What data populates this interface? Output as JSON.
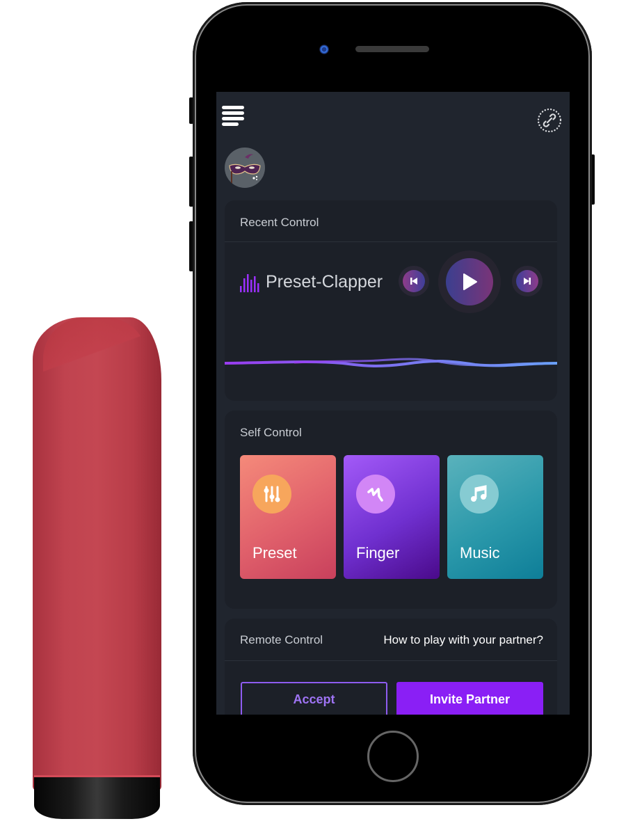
{
  "app": {
    "header": {
      "menu_icon": "hamburger-menu-icon",
      "link_icon": "link-dotted-circle-icon",
      "avatar_icon": "masquerade-mask-avatar"
    },
    "recent_control": {
      "title": "Recent Control",
      "track_icon": "equalizer-bars-icon",
      "track_name": "Preset-Clapper",
      "controls": {
        "prev_icon": "skip-previous-icon",
        "play_icon": "play-icon",
        "next_icon": "skip-next-icon"
      }
    },
    "self_control": {
      "title": "Self Control",
      "tiles": [
        {
          "label": "Preset",
          "icon": "sliders-icon",
          "color": "#e0606b"
        },
        {
          "label": "Finger",
          "icon": "finger-squiggle-icon",
          "color": "#7030d0"
        },
        {
          "label": "Music",
          "icon": "music-note-icon",
          "color": "#2a98aa"
        }
      ]
    },
    "remote_control": {
      "title": "Remote Control",
      "help_link": "How to play with your partner?",
      "accept_label": "Accept",
      "invite_label": "Invite Partner"
    },
    "colors": {
      "accent": "#8a1ff5",
      "screen_bg": "#20252e",
      "card_bg": "#1c2028"
    }
  }
}
